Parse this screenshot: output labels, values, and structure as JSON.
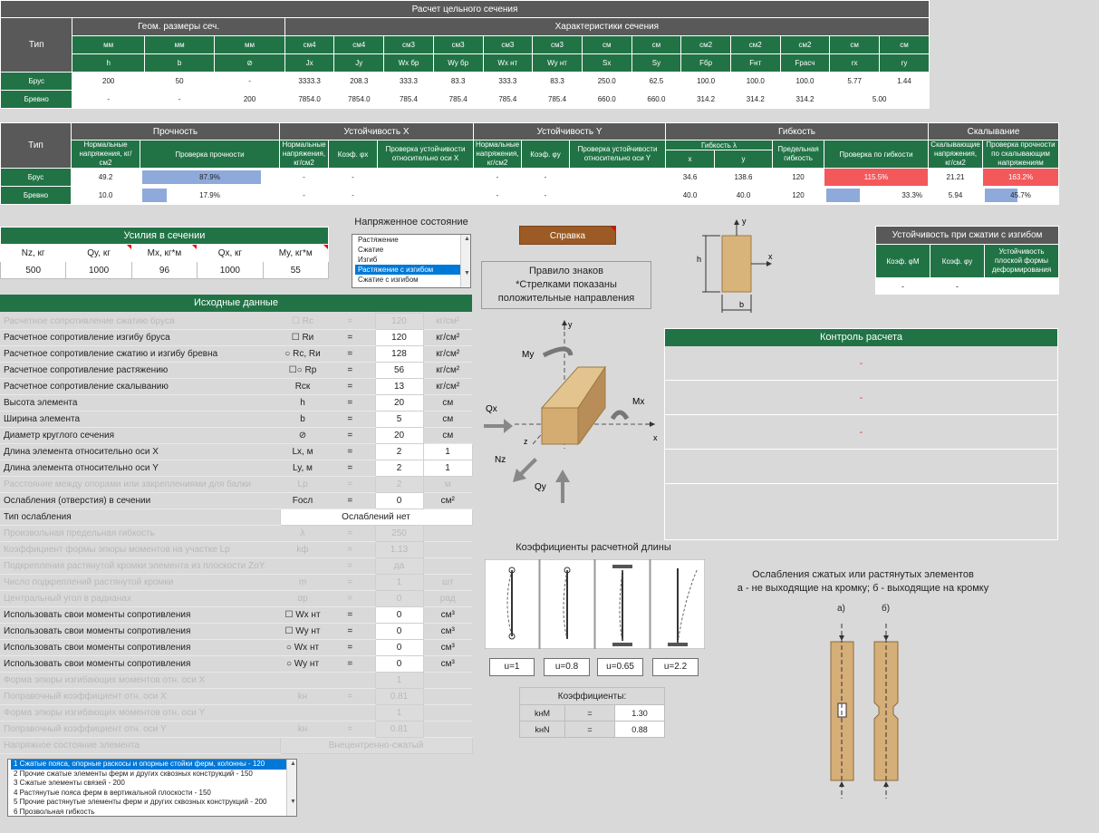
{
  "t1": {
    "title": "Расчет цельного сечения",
    "type_label": "Тип",
    "geom_label": "Геом. размеры сеч.",
    "char_label": "Характеристики сечения",
    "units": [
      "мм",
      "мм",
      "мм",
      "см4",
      "см4",
      "см3",
      "см3",
      "см3",
      "см3",
      "см",
      "см",
      "см2",
      "см2",
      "см2",
      "см",
      "см"
    ],
    "names": [
      "h",
      "b",
      "⊘",
      "Jx",
      "Jy",
      "Wx бр",
      "Wy бр",
      "Wx нт",
      "Wy нт",
      "Sx",
      "Sy",
      "Fбр",
      "Fнт",
      "Fрасч",
      "rx",
      "ry"
    ],
    "rows": [
      {
        "label": "Брус",
        "cells": [
          "200",
          "50",
          "-",
          "3333.3",
          "208.3",
          "333.3",
          "83.3",
          "333.3",
          "83.3",
          "250.0",
          "62.5",
          "100.0",
          "100.0",
          "100.0",
          "5.77",
          "1.44"
        ]
      },
      {
        "label": "Бревно",
        "cells": [
          "-",
          "-",
          "200",
          "7854.0",
          "7854.0",
          "785.4",
          "785.4",
          "785.4",
          "785.4",
          "660.0",
          "660.0",
          "314.2",
          "314.2",
          "314.2",
          "5.00"
        ]
      }
    ]
  },
  "t2": {
    "type_label": "Тип",
    "groups": [
      "Прочность",
      "Устойчивость X",
      "Устойчивость Y",
      "Гибкость",
      "Скалывание"
    ],
    "h_norm1": "Нормальные напряжения, кг/см2",
    "h_check1": "Проверка прочности",
    "h_norm2": "Нормальные напряжения, кг/см2",
    "h_coefx": "Коэф. φx",
    "h_checkx": "Проверка устойчивости относительно оси X",
    "h_norm3": "Нормальные напряжения, кг/см2",
    "h_coefy": "Коэф. φy",
    "h_checky": "Проверка устойчивости относительно оси Y",
    "h_flex": "Гибкость λ",
    "h_fx": "x",
    "h_fy": "y",
    "h_limit": "Предельная гибкость",
    "h_flexcheck": "Проверка по гибкости",
    "h_shear": "Скалывающие напряжения, кг/см2",
    "h_shearcheck": "Проверка прочности по скалывающим напряжениям",
    "rows": [
      {
        "label": "Брус",
        "norm": "49.2",
        "strength": "87.9%",
        "strength_frac": 0.879,
        "n2": "-",
        "fx": "-",
        "n3": "-",
        "fy": "-",
        "lx": "34.6",
        "ly": "138.6",
        "lim": "120",
        "flex": "115.5%",
        "shear": "21.21",
        "shearchk": "163.2%"
      },
      {
        "label": "Бревно",
        "norm": "10.0",
        "strength": "17.9%",
        "strength_frac": 0.179,
        "n2": "-",
        "fx": "-",
        "n3": "-",
        "fy": "-",
        "lx": "40.0",
        "ly": "40.0",
        "lim": "120",
        "flex": "33.3%",
        "flex_frac": 0.333,
        "shear": "5.94",
        "shearchk": "45.7%",
        "shear_frac": 0.457
      }
    ]
  },
  "forces": {
    "title": "Усилия в сечении",
    "headers": [
      "Nz, кг",
      "Qy, кг",
      "Mx, кг*м",
      "Qx, кг",
      "My, кг*м"
    ],
    "values": [
      "500",
      "1000",
      "96",
      "1000",
      "55"
    ]
  },
  "stress": {
    "title": "Напряженное состояние",
    "options": [
      "Растяжение",
      "Сжатие",
      "Изгиб",
      "Растяжение с изгибом",
      "Сжатие с изгибом"
    ],
    "selected": 3
  },
  "help_button": "Справка",
  "sign_rule": [
    "Правило знаков",
    "*Стрелками показаны",
    "положительные направления"
  ],
  "stab": {
    "title": "Устойчивость при сжатии с изгибом",
    "headers": [
      "Коэф. φM",
      "Коэф. φy",
      "Устойчивость плоской формы деформирования"
    ],
    "values": [
      "-",
      "-",
      ""
    ]
  },
  "section_labels": {
    "h": "h",
    "b": "b",
    "x": "x",
    "y": "y"
  },
  "beam_labels": {
    "my": "My",
    "mx": "Mx",
    "qx": "Qx",
    "nz": "Nz",
    "qy": "Qy",
    "x": "x",
    "y": "y",
    "z": "z"
  },
  "control": {
    "title": "Контроль расчета",
    "lines": [
      "-",
      "-",
      "-"
    ]
  },
  "input": {
    "title": "Исходные данные",
    "rows": [
      {
        "label": "Расчетное сопротивление сжатию бруса",
        "sym": "☐ Rс",
        "eq": "=",
        "val": "120",
        "unit": "кг/см²",
        "extra": "",
        "dis": true
      },
      {
        "label": "Расчетное сопротивление изгибу бруса",
        "sym": "☐ Rи",
        "eq": "=",
        "val": "120",
        "unit": "кг/см²",
        "extra": "",
        "dis": false
      },
      {
        "label": "Расчетное сопротивление сжатию и изгибу бревна",
        "sym": "○ Rс, Rи",
        "eq": "=",
        "val": "128",
        "unit": "кг/см²",
        "extra": "",
        "dis": false
      },
      {
        "label": "Расчетное сопротивление растяжению",
        "sym": "☐○ Rр",
        "eq": "=",
        "val": "56",
        "unit": "кг/см²",
        "extra": "",
        "dis": false
      },
      {
        "label": "Расчетное сопротивление скалыванию",
        "sym": "Rск",
        "eq": "=",
        "val": "13",
        "unit": "кг/см²",
        "extra": "",
        "dis": false
      },
      {
        "label": "Высота элемента",
        "sym": "h",
        "eq": "=",
        "val": "20",
        "unit": "см",
        "extra": "",
        "dis": false
      },
      {
        "label": "Ширина элемента",
        "sym": "b",
        "eq": "=",
        "val": "5",
        "unit": "см",
        "extra": "",
        "dis": false
      },
      {
        "label": "Диаметр круглого сечения",
        "sym": "⊘",
        "eq": "=",
        "val": "20",
        "unit": "см",
        "extra": "",
        "dis": false
      },
      {
        "label": "Длина элемента относительно оси X",
        "sym": "Lx, м",
        "eq": "=",
        "val": "2",
        "unit": "",
        "extra": "1",
        "dis": false
      },
      {
        "label": "Длина элемента относительно оси Y",
        "sym": "Ly, м",
        "eq": "=",
        "val": "2",
        "unit": "",
        "extra": "1",
        "dis": false
      },
      {
        "label": "Расстояние между опорами или закреплениями для балки",
        "sym": "Lp",
        "eq": "=",
        "val": "2",
        "unit": "м",
        "extra": "",
        "dis": true
      },
      {
        "label": "Ослабления (отверстия) в сечении",
        "sym": "Fосл",
        "eq": "=",
        "val": "0",
        "unit": "см²",
        "extra": "",
        "dis": false
      },
      {
        "label": "Тип ослабления",
        "wide": "Ослаблений нет",
        "dis": false
      },
      {
        "label": "Произвольная предельная гибкость",
        "sym": "λ",
        "eq": "=",
        "val": "250",
        "unit": "",
        "extra": "",
        "dis": true
      },
      {
        "label": "Коэффициент формы эпюры моментов на участке Lp",
        "sym": "kф",
        "eq": "=",
        "val": "1.13",
        "unit": "",
        "extra": "",
        "dis": true
      },
      {
        "label": "Подкрепления растянутой кромки элемента из плоскости ZoY",
        "sym": "",
        "eq": "=",
        "val": "да",
        "unit": "",
        "extra": "",
        "dis": true
      },
      {
        "label": "Число подкреплений растянутой кромки",
        "sym": "m",
        "eq": "=",
        "val": "1",
        "unit": "шт",
        "extra": "",
        "dis": true
      },
      {
        "label": "Центральный угол в радианах",
        "sym": "αр",
        "eq": "=",
        "val": "0",
        "unit": "рад",
        "extra": "",
        "dis": true
      },
      {
        "label": "Использовать свои моменты сопротивления",
        "sym": "☐ Wx нт",
        "eq": "=",
        "val": "0",
        "unit": "см³",
        "extra": "",
        "dis": false
      },
      {
        "label": "Использовать свои моменты сопротивления",
        "sym": "☐ Wy нт",
        "eq": "=",
        "val": "0",
        "unit": "см³",
        "extra": "",
        "dis": false
      },
      {
        "label": "Использовать свои моменты сопротивления",
        "sym": "○ Wx нт",
        "eq": "=",
        "val": "0",
        "unit": "см³",
        "extra": "",
        "dis": false
      },
      {
        "label": "Использовать свои моменты сопротивления",
        "sym": "○ Wy нт",
        "eq": "=",
        "val": "0",
        "unit": "см³",
        "extra": "",
        "dis": false
      },
      {
        "label": "Форма эпюры изгибающих моментов отн. оси X",
        "sym": "",
        "eq": "",
        "val": "1",
        "unit": "",
        "extra": "",
        "dis": true
      },
      {
        "label": "Поправочный коэффициент отн. оси X",
        "sym": "kн",
        "eq": "=",
        "val": "0.81",
        "unit": "",
        "extra": "",
        "dis": true
      },
      {
        "label": "Форма эпюры изгибающих моментов отн. оси Y",
        "sym": "",
        "eq": "",
        "val": "1",
        "unit": "",
        "extra": "",
        "dis": true
      },
      {
        "label": "Поправочный коэффициент отн. оси Y",
        "sym": "kн",
        "eq": "=",
        "val": "0.81",
        "unit": "",
        "extra": "",
        "dis": true
      },
      {
        "label": "Напряжное состояние элемента",
        "wide": "Внецентренно-сжатый",
        "dis": true
      }
    ]
  },
  "len_coef": {
    "title": "Коэффициенты расчетной длины",
    "labels": [
      "u=1",
      "u=0.8",
      "u=0.65",
      "u=2.2"
    ]
  },
  "coefs": {
    "title": "Коэффициенты:",
    "rows": [
      {
        "name": "kнМ",
        "eq": "=",
        "val": "1.30"
      },
      {
        "name": "kнN",
        "eq": "=",
        "val": "0.88"
      }
    ]
  },
  "weak": {
    "line1": "Ослабления сжатых или растянутых элементов",
    "line2": "а - не выходящие на кромку; б - выходящие на кромку",
    "a": "а)",
    "b": "б)"
  },
  "flex_list": {
    "items": [
      "1 Сжатые пояса, опорные раскосы и опорные стойки ферм, колонны - 120",
      "2 Прочие сжатые элементы ферм и других сквозных конструкций - 150",
      "3 Сжатые элементы связей - 200",
      "4 Растянутые пояса ферм в вертикальной плоскости - 150",
      "5 Прочие растянутые элементы ферм и других сквозных конструкций - 200",
      "6 Прозвольная гибкость"
    ],
    "selected": 0
  }
}
